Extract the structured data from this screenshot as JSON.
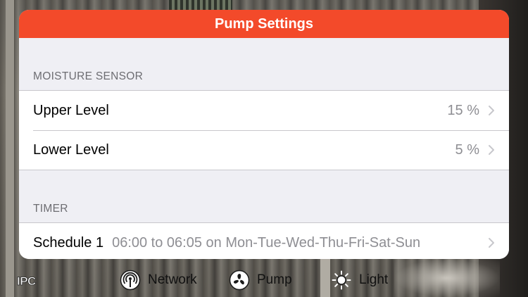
{
  "modal": {
    "title": "Pump Settings"
  },
  "sections": [
    {
      "header": "MOISTURE SENSOR",
      "rows": [
        {
          "label": "Upper Level",
          "value": "15 %"
        },
        {
          "label": "Lower Level",
          "value": "5 %"
        }
      ]
    },
    {
      "header": "TIMER",
      "rows": [
        {
          "label": "Schedule 1",
          "detail": "06:00 to 06:05 on Mon-Tue-Wed-Thu-Fri-Sat-Sun"
        }
      ]
    }
  ],
  "toolbar": {
    "logo": "IPC",
    "tabs": [
      {
        "label": "Network",
        "icon": "network-signal-icon"
      },
      {
        "label": "Pump",
        "icon": "fan-icon"
      },
      {
        "label": "Light",
        "icon": "sun-icon"
      }
    ]
  },
  "colors": {
    "header_accent": "#f34a2a",
    "secondary_text": "#8e8e93",
    "grouped_background": "#efeff4"
  }
}
